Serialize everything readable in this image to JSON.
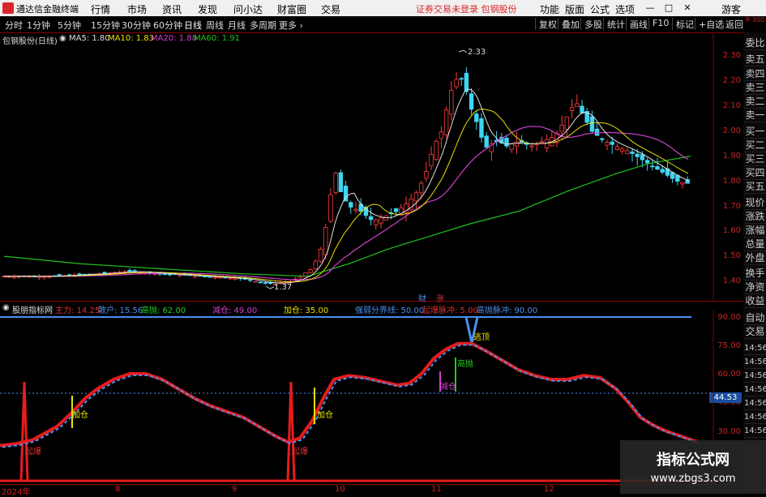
{
  "titlebar": {
    "app_name": "通达信金融终端",
    "menus": [
      "行情",
      "市场",
      "资讯",
      "发现",
      "问小达",
      "财富圈",
      "交易"
    ],
    "notice": "证券交易未登录 包钢股份",
    "tools": [
      "功能",
      "版面",
      "公式",
      "选项"
    ],
    "guest": "游客"
  },
  "periods": [
    "分时",
    "1分钟",
    "5分钟",
    "15分钟",
    "30分钟",
    "60分钟",
    "日线",
    "周线",
    "月线",
    "多周期",
    "更多"
  ],
  "selected_period": "日线",
  "toolbar": [
    "复权",
    "叠加",
    "多股",
    "统计",
    "画线",
    "F10",
    "标记",
    "+自选",
    "返回"
  ],
  "main_chart": {
    "stock": "包钢股份(日线)",
    "ma_labels": [
      {
        "text": "MA5: 1.80",
        "color": "#e0e0e0"
      },
      {
        "text": "MA10: 1.83",
        "color": "#e8e000"
      },
      {
        "text": "MA20: 1.88",
        "color": "#d040d0"
      },
      {
        "text": "MA60: 1.91",
        "color": "#20c020"
      }
    ],
    "price_axis": [
      "2.30",
      "2.20",
      "2.10",
      "2.00",
      "1.90",
      "1.80",
      "1.70",
      "1.60",
      "1.50",
      "1.40"
    ],
    "high_label": "2.33",
    "low_label": "1.37",
    "event_tags": [
      "财",
      "涨"
    ]
  },
  "indicator": {
    "name": "股朋指标网",
    "values": [
      {
        "text": "主力: 14.25",
        "color": "#e03030"
      },
      {
        "text": "散户: 15.56",
        "color": "#4a8ff0"
      },
      {
        "text": "高抛: 62.00",
        "color": "#20d020"
      },
      {
        "text": "减仓: 49.00",
        "color": "#d040d0"
      },
      {
        "text": "加仓: 35.00",
        "color": "#e8e000"
      },
      {
        "text": "强弱分界线: 50.00",
        "color": "#4a8ff0"
      },
      {
        "text": "起爆脉冲: 5.00",
        "color": "#e03030"
      },
      {
        "text": "高抛脉冲: 90.00",
        "color": "#4a8ff0"
      }
    ],
    "axis": [
      "90.00",
      "75.00",
      "60.00",
      "45.00",
      "30.00"
    ],
    "current_value": "44.53",
    "annotations": {
      "jiacang": "加仓",
      "qibao": "起爆",
      "gaopao": "高抛",
      "jiancang": "减仓",
      "taoding": "逃顶"
    }
  },
  "date_axis": [
    "2024年",
    "8",
    "9",
    "10",
    "11",
    "12"
  ],
  "side_panel": [
    "委比",
    "卖五",
    "卖四",
    "卖三",
    "卖二",
    "卖一",
    "买一",
    "买二",
    "买三",
    "买四",
    "买五",
    "现价",
    "涨跌",
    "涨幅",
    "总量",
    "外盘",
    "换手",
    "净资",
    "收益",
    "自动",
    "交易"
  ],
  "side_times": [
    "14:56",
    "14:56",
    "14:56",
    "14:56",
    "14:56",
    "14:56",
    "14:56"
  ],
  "corner_label": "R 300",
  "watermark": {
    "title": "指标公式网",
    "url": "www.zbgs3.com"
  },
  "colors": {
    "up": "#ff3b3b",
    "down": "#3fd4f0",
    "ma5": "#e0e0e0",
    "ma10": "#e8e000",
    "ma20": "#d040d0",
    "ma60": "#20c020",
    "zhuli": "#e81c1c",
    "sanhu": "#4a8ff0"
  }
}
